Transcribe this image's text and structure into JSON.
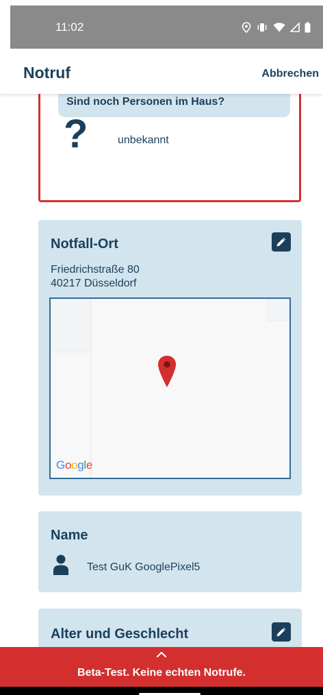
{
  "status_bar": {
    "time": "11:02",
    "icons": [
      "location-icon",
      "vibrate-icon",
      "wifi-icon",
      "signal-icon",
      "battery-icon"
    ]
  },
  "app_bar": {
    "title": "Notruf",
    "cancel_label": "Abbrechen"
  },
  "persons": {
    "question": "Sind noch Personen im Haus?",
    "icon": "?",
    "answer": "unbekannt"
  },
  "location": {
    "title": "Notfall-Ort",
    "street": "Friedrichstraße 80",
    "city": "40217 Düsseldorf",
    "map_provider": "Google"
  },
  "name_card": {
    "title": "Name",
    "value": "Test GuK GooglePixel5"
  },
  "age_card": {
    "title": "Alter und Geschlecht"
  },
  "banner": {
    "text": "Beta-Test. Keine echten Notrufe."
  },
  "colors": {
    "primary": "#1b3f5a",
    "card_background": "#d2e4ee",
    "alert_red": "#d32f2f",
    "map_pin": "#d32f2f"
  }
}
